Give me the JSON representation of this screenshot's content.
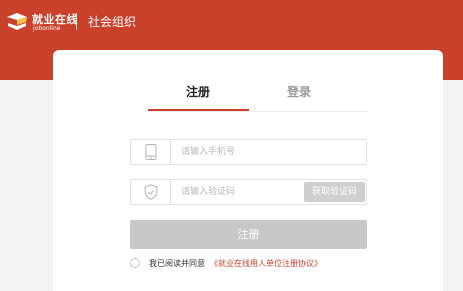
{
  "header": {
    "logo_cn": "就业在线",
    "logo_en": "jobonline",
    "title": "社会组织"
  },
  "tabs": [
    {
      "label": "注册",
      "active": true
    },
    {
      "label": "登录",
      "active": false
    }
  ],
  "phone": {
    "icon": "phone-icon",
    "placeholder": "请输入手机号",
    "value": ""
  },
  "code": {
    "icon": "shield-icon",
    "placeholder": "请输入验证码",
    "value": "",
    "button_label": "获取验证码"
  },
  "submit": {
    "label": "注册"
  },
  "agreement": {
    "text": "我已阅读并同意",
    "link": "《就业在线用人单位注册协议》",
    "checked": false
  },
  "colors": {
    "brand": "#c9412a",
    "disabled_button": "#c8c8c8",
    "background": "#f3f3f3"
  }
}
